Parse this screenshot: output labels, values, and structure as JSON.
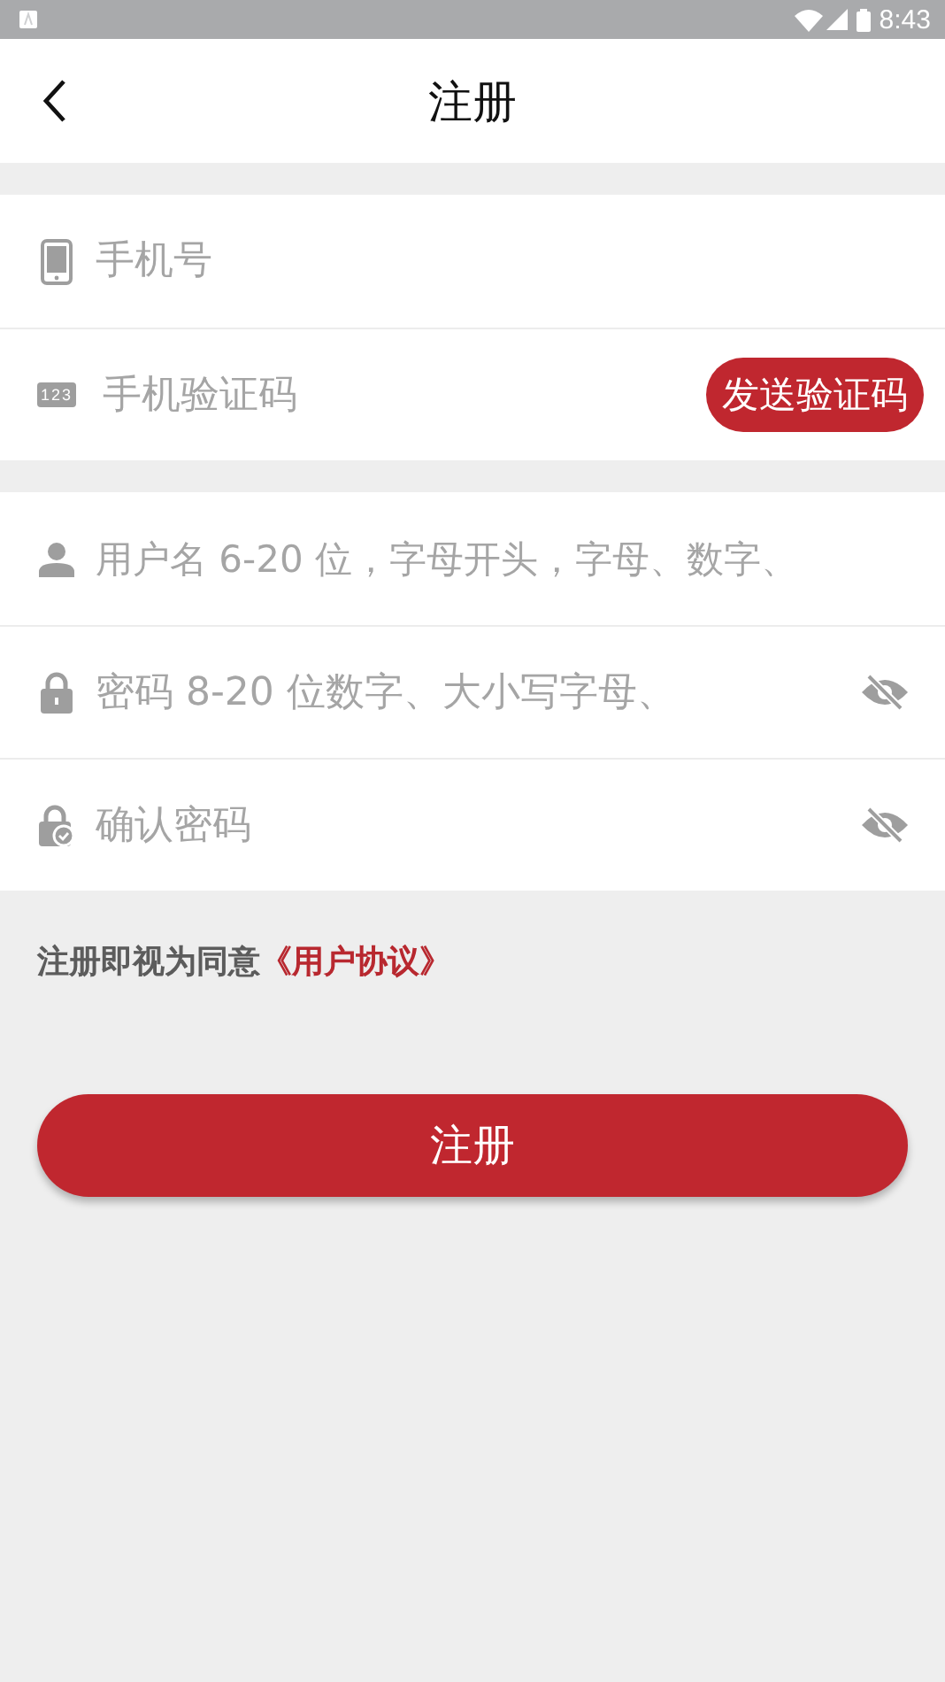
{
  "status_bar": {
    "time": "8:43"
  },
  "header": {
    "title": "注册"
  },
  "groups": [
    {
      "fields": [
        {
          "kind": "phone",
          "placeholder": "手机号"
        },
        {
          "kind": "code",
          "icon_text": "123",
          "placeholder": "手机验证码",
          "button": "发送验证码"
        }
      ]
    },
    {
      "fields": [
        {
          "kind": "user",
          "placeholder": "用户名 6-20 位，字母开头，字母、数字、"
        },
        {
          "kind": "password",
          "placeholder": "密码 8-20 位数字、大小写字母、",
          "visible": false
        },
        {
          "kind": "confirm",
          "placeholder": "确认密码",
          "visible": false
        }
      ]
    }
  ],
  "agreement": {
    "text": "注册即视为同意",
    "link": "《用户协议》"
  },
  "submit": "注册"
}
